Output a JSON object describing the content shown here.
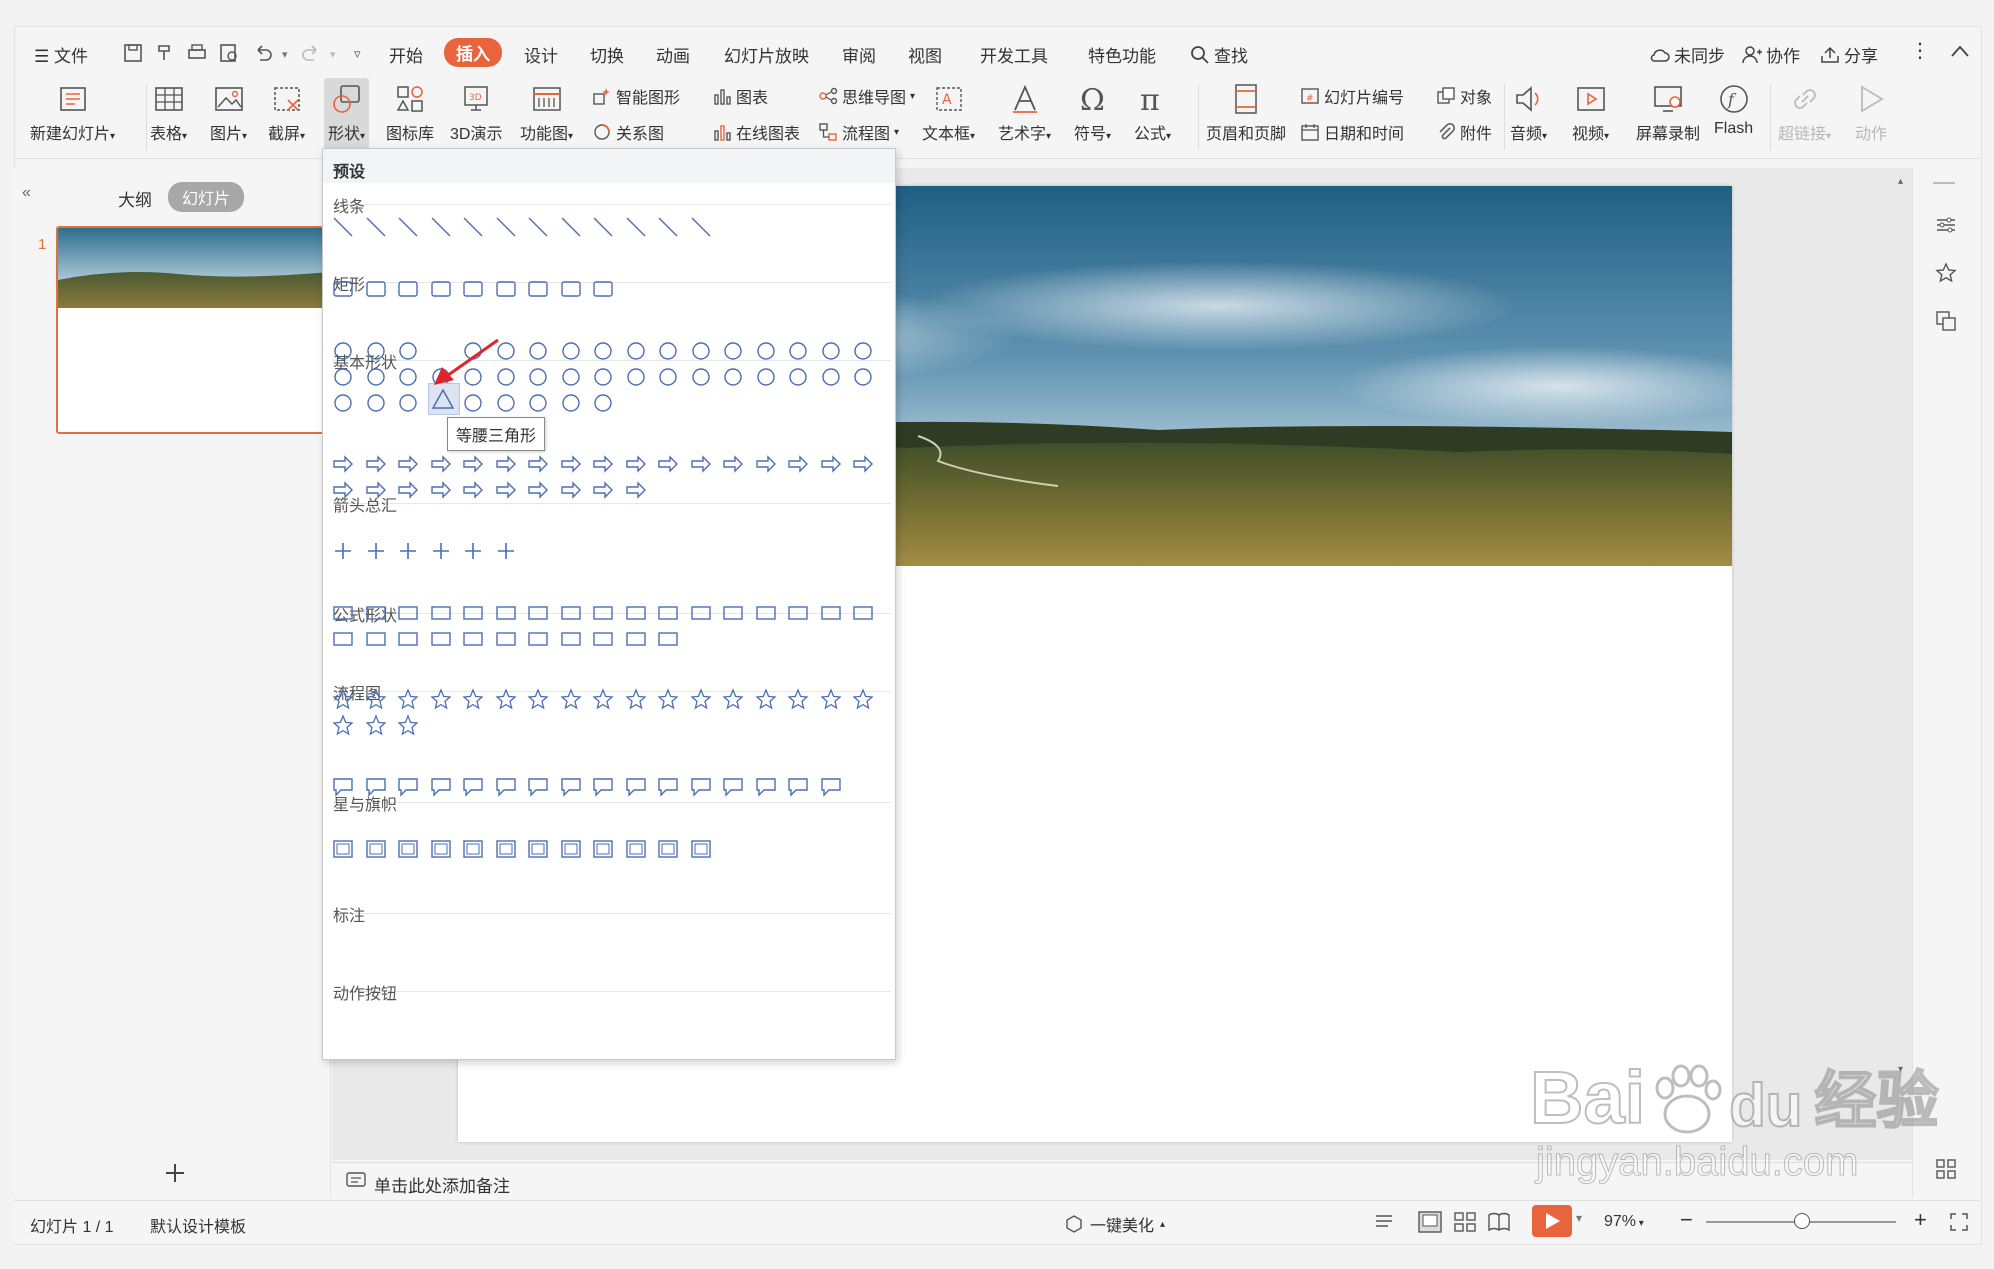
{
  "menu": {
    "file": "文件",
    "tabs": [
      "开始",
      "插入",
      "设计",
      "切换",
      "动画",
      "幻灯片放映",
      "审阅",
      "视图",
      "开发工具",
      "特色功能"
    ],
    "search": "查找",
    "right": [
      "未同步",
      "协作",
      "分享"
    ]
  },
  "ribbon": {
    "new_slide": "新建幻灯片",
    "table": "表格",
    "picture": "图片",
    "screenshot": "截屏",
    "shape": "形状",
    "icon_lib": "图标库",
    "demo3d": "3D演示",
    "func_chart": "功能图",
    "smart_art": "智能图形",
    "relation": "关系图",
    "chart": "图表",
    "online_chart": "在线图表",
    "mind_map": "思维导图",
    "flow_chart": "流程图",
    "textbox": "文本框",
    "art_text": "艺术字",
    "symbol": "符号",
    "formula": "公式",
    "header_footer": "页眉和页脚",
    "slide_number": "幻灯片编号",
    "object": "对象",
    "date_time": "日期和时间",
    "attachment": "附件",
    "audio": "音频",
    "video": "视频",
    "screen_record": "屏幕录制",
    "flash": "Flash",
    "hyperlink": "超链接",
    "action": "动作"
  },
  "leftpanel": {
    "tab_outline": "大纲",
    "tab_slides": "幻灯片",
    "slide_no": "1"
  },
  "notes": {
    "placeholder": "单击此处添加备注"
  },
  "status": {
    "slide_info": "幻灯片 1 / 1",
    "template": "默认设计模板",
    "beautify": "一键美化",
    "zoom": "97%"
  },
  "dropdown": {
    "header": "预设",
    "sections": [
      "线条",
      "矩形",
      "基本形状",
      "箭头总汇",
      "公式形状",
      "流程图",
      "星与旗帜",
      "标注",
      "动作按钮"
    ],
    "tooltip": "等腰三角形"
  },
  "watermark": {
    "brand": "Bai",
    "brand2": "du",
    "cn": "经验",
    "url": "jingyan.baidu.com"
  },
  "colors": {
    "accent": "#e8643c",
    "shape_stroke": "#4a6fb5",
    "arrow": "#e0242b"
  }
}
